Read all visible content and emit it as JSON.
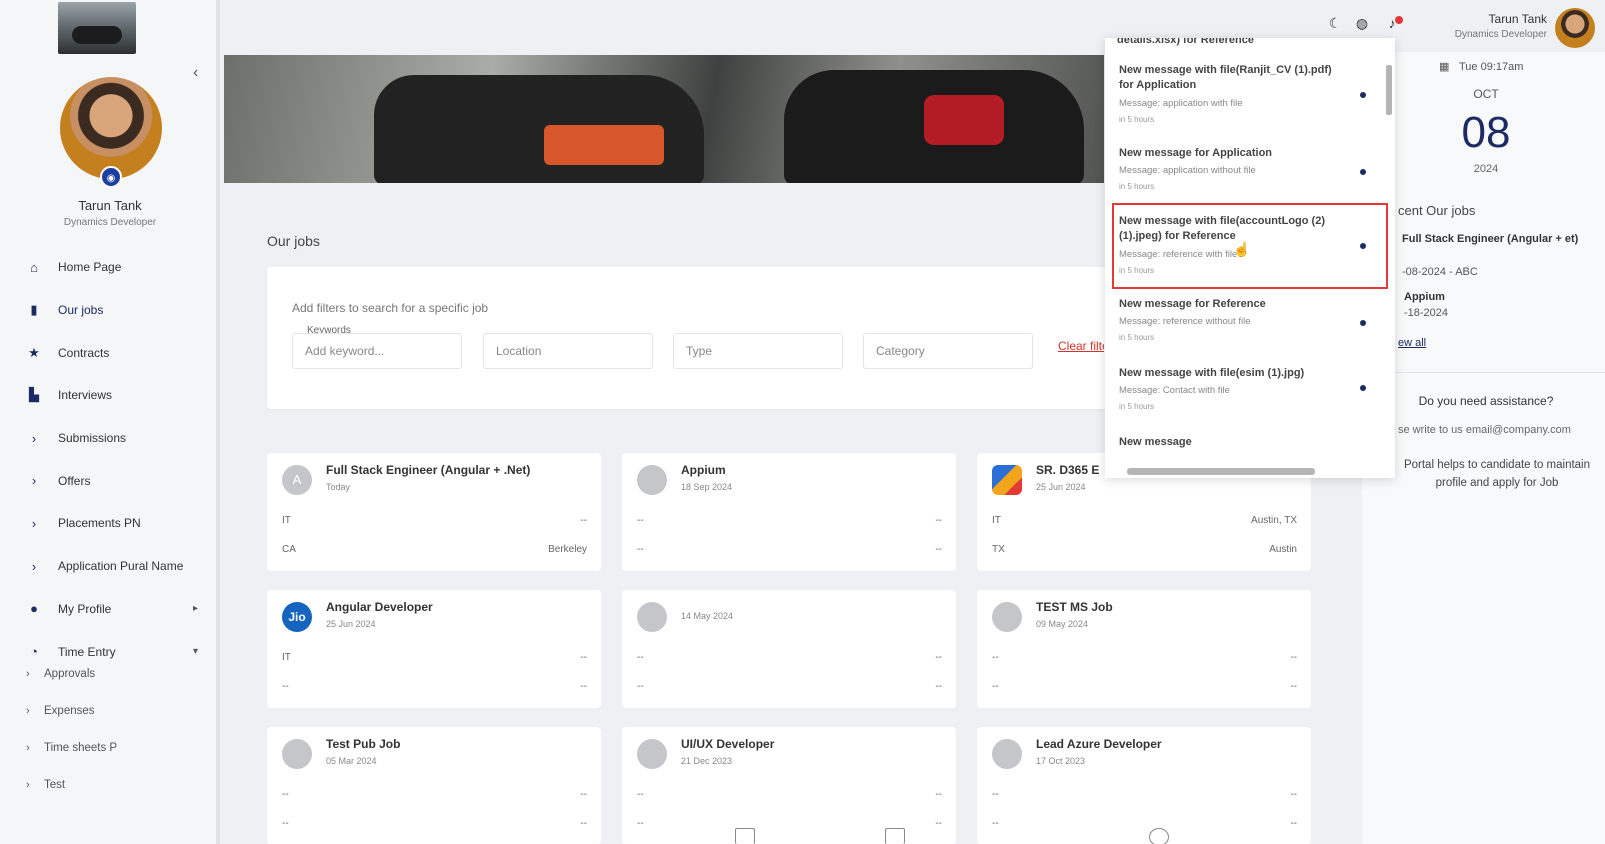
{
  "sidebar": {
    "profile_name": "Tarun Tank",
    "profile_role": "Dynamics Developer",
    "collapse_icon": "chevron-left-icon",
    "nav": [
      {
        "label": "Home Page",
        "icon": "home-icon",
        "glyph": "⌂"
      },
      {
        "label": "Our jobs",
        "icon": "briefcase-icon",
        "glyph": "▮"
      },
      {
        "label": "Contracts",
        "icon": "star-icon",
        "glyph": "★"
      },
      {
        "label": "Interviews",
        "icon": "chart-icon",
        "glyph": "▙"
      },
      {
        "label": "Submissions",
        "icon": "chevron-right-icon",
        "glyph": "›"
      },
      {
        "label": "Offers",
        "icon": "chevron-right-icon",
        "glyph": "›"
      },
      {
        "label": "Placements PN",
        "icon": "chevron-right-icon",
        "glyph": "›"
      },
      {
        "label": "Application Pural Name",
        "icon": "chevron-right-icon",
        "glyph": "›"
      },
      {
        "label": "My Profile",
        "icon": "user-icon",
        "glyph": "●"
      },
      {
        "label": "Time Entry",
        "icon": "clock-icon",
        "glyph": "◔"
      }
    ],
    "subnav": [
      {
        "label": "Approvals"
      },
      {
        "label": "Expenses"
      },
      {
        "label": "Time sheets P"
      },
      {
        "label": "Test"
      }
    ]
  },
  "topbar": {
    "user_name": "Tarun Tank",
    "user_role": "Dynamics Developer",
    "icons": [
      "moon-icon",
      "globe-icon",
      "bell-icon"
    ]
  },
  "main": {
    "section_title": "Our jobs",
    "filter_hint": "Add filters to search for a specific job",
    "keywords_label": "Keywords",
    "keyword_placeholder": "Add keyword...",
    "location_placeholder": "Location",
    "type_placeholder": "Type",
    "category_placeholder": "Category",
    "clear_label": "Clear filters"
  },
  "jobs": [
    {
      "title": "Full Stack Engineer (Angular + .Net)",
      "date": "Today",
      "logo": "A",
      "rows": [
        [
          "IT",
          "--"
        ],
        [
          "CA",
          "Berkeley"
        ]
      ]
    },
    {
      "title": "Appium",
      "date": "18 Sep 2024",
      "logo": "",
      "rows": [
        [
          "--",
          "--"
        ],
        [
          "--",
          "--"
        ]
      ]
    },
    {
      "title": "SR. D365 E",
      "date": "25 Jun 2024",
      "logo": "",
      "rows": [
        [
          "IT",
          "Austin, TX"
        ],
        [
          "TX",
          "Austin"
        ]
      ]
    },
    {
      "title": "Angular Developer",
      "date": "25 Jun 2024",
      "logo": "Jio",
      "rows": [
        [
          "IT",
          "--"
        ],
        [
          "--",
          "--"
        ]
      ]
    },
    {
      "title": "",
      "date": "14 May 2024",
      "logo": "",
      "rows": [
        [
          "--",
          "--"
        ],
        [
          "--",
          "--"
        ]
      ]
    },
    {
      "title": "TEST MS Job",
      "date": "09 May 2024",
      "logo": "",
      "rows": [
        [
          "--",
          "--"
        ],
        [
          "--",
          "--"
        ]
      ]
    },
    {
      "title": "Test Pub Job",
      "date": "05 Mar 2024",
      "logo": "",
      "rows": [
        [
          "--",
          "--"
        ],
        [
          "--",
          "--"
        ]
      ]
    },
    {
      "title": "UI/UX Developer",
      "date": "21 Dec 2023",
      "logo": "",
      "rows": [
        [
          "--",
          "--"
        ],
        [
          "--",
          "--"
        ]
      ]
    },
    {
      "title": "Lead Azure Developer",
      "date": "17 Oct 2023",
      "logo": "",
      "rows": [
        [
          "--",
          "--"
        ],
        [
          "--",
          "--"
        ]
      ]
    }
  ],
  "notifications": {
    "cut_title": "details.xlsx) for Reference",
    "items": [
      {
        "title": "New message with file(Ranjit_CV (1).pdf) for Application",
        "message": "Message: application with file",
        "time": "in 5 hours"
      },
      {
        "title": "New message for Application",
        "message": "Message: application without file",
        "time": "in 5 hours"
      },
      {
        "title": "New message with file(accountLogo (2) (1).jpeg) for Reference",
        "message": "Message: reference with file",
        "time": "in 5 hours"
      },
      {
        "title": "New message for Reference",
        "message": "Message: reference without file",
        "time": "in 5 hours"
      },
      {
        "title": "New message with file(esim (1).jpg)",
        "message": "Message:  Contact with file",
        "time": "in 5 hours"
      },
      {
        "title": "New message",
        "message": "",
        "time": ""
      }
    ]
  },
  "right_panel": {
    "datetime": "Tue 09:17am",
    "month": "OCT",
    "day": "08",
    "year": "2024",
    "recent_title": "cent Our jobs",
    "recent_jobs": [
      {
        "title": "Full Stack Engineer (Angular + et)",
        "meta": "-08-2024 - ABC"
      },
      {
        "title": "Appium",
        "meta": "-18-2024"
      }
    ],
    "view_all": "ew all",
    "assist_title": "Do you need assistance?",
    "assist_write": "se write to us email@company.com",
    "portal_text": "Portal helps to candidate to maintain profile and apply for Job"
  },
  "colors": {
    "accent": "#1c2b63",
    "danger": "#e53935",
    "link_red": "#d0342c"
  }
}
